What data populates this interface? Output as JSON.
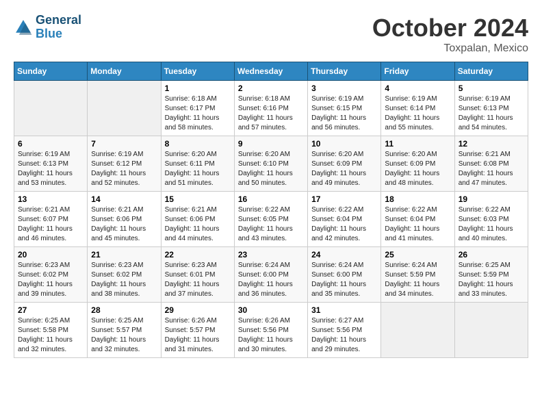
{
  "header": {
    "logo_line1": "General",
    "logo_line2": "Blue",
    "month": "October 2024",
    "location": "Toxpalan, Mexico"
  },
  "weekdays": [
    "Sunday",
    "Monday",
    "Tuesday",
    "Wednesday",
    "Thursday",
    "Friday",
    "Saturday"
  ],
  "weeks": [
    [
      {
        "day": "",
        "info": ""
      },
      {
        "day": "",
        "info": ""
      },
      {
        "day": "1",
        "info": "Sunrise: 6:18 AM\nSunset: 6:17 PM\nDaylight: 11 hours and 58 minutes."
      },
      {
        "day": "2",
        "info": "Sunrise: 6:18 AM\nSunset: 6:16 PM\nDaylight: 11 hours and 57 minutes."
      },
      {
        "day": "3",
        "info": "Sunrise: 6:19 AM\nSunset: 6:15 PM\nDaylight: 11 hours and 56 minutes."
      },
      {
        "day": "4",
        "info": "Sunrise: 6:19 AM\nSunset: 6:14 PM\nDaylight: 11 hours and 55 minutes."
      },
      {
        "day": "5",
        "info": "Sunrise: 6:19 AM\nSunset: 6:13 PM\nDaylight: 11 hours and 54 minutes."
      }
    ],
    [
      {
        "day": "6",
        "info": "Sunrise: 6:19 AM\nSunset: 6:13 PM\nDaylight: 11 hours and 53 minutes."
      },
      {
        "day": "7",
        "info": "Sunrise: 6:19 AM\nSunset: 6:12 PM\nDaylight: 11 hours and 52 minutes."
      },
      {
        "day": "8",
        "info": "Sunrise: 6:20 AM\nSunset: 6:11 PM\nDaylight: 11 hours and 51 minutes."
      },
      {
        "day": "9",
        "info": "Sunrise: 6:20 AM\nSunset: 6:10 PM\nDaylight: 11 hours and 50 minutes."
      },
      {
        "day": "10",
        "info": "Sunrise: 6:20 AM\nSunset: 6:09 PM\nDaylight: 11 hours and 49 minutes."
      },
      {
        "day": "11",
        "info": "Sunrise: 6:20 AM\nSunset: 6:09 PM\nDaylight: 11 hours and 48 minutes."
      },
      {
        "day": "12",
        "info": "Sunrise: 6:21 AM\nSunset: 6:08 PM\nDaylight: 11 hours and 47 minutes."
      }
    ],
    [
      {
        "day": "13",
        "info": "Sunrise: 6:21 AM\nSunset: 6:07 PM\nDaylight: 11 hours and 46 minutes."
      },
      {
        "day": "14",
        "info": "Sunrise: 6:21 AM\nSunset: 6:06 PM\nDaylight: 11 hours and 45 minutes."
      },
      {
        "day": "15",
        "info": "Sunrise: 6:21 AM\nSunset: 6:06 PM\nDaylight: 11 hours and 44 minutes."
      },
      {
        "day": "16",
        "info": "Sunrise: 6:22 AM\nSunset: 6:05 PM\nDaylight: 11 hours and 43 minutes."
      },
      {
        "day": "17",
        "info": "Sunrise: 6:22 AM\nSunset: 6:04 PM\nDaylight: 11 hours and 42 minutes."
      },
      {
        "day": "18",
        "info": "Sunrise: 6:22 AM\nSunset: 6:04 PM\nDaylight: 11 hours and 41 minutes."
      },
      {
        "day": "19",
        "info": "Sunrise: 6:22 AM\nSunset: 6:03 PM\nDaylight: 11 hours and 40 minutes."
      }
    ],
    [
      {
        "day": "20",
        "info": "Sunrise: 6:23 AM\nSunset: 6:02 PM\nDaylight: 11 hours and 39 minutes."
      },
      {
        "day": "21",
        "info": "Sunrise: 6:23 AM\nSunset: 6:02 PM\nDaylight: 11 hours and 38 minutes."
      },
      {
        "day": "22",
        "info": "Sunrise: 6:23 AM\nSunset: 6:01 PM\nDaylight: 11 hours and 37 minutes."
      },
      {
        "day": "23",
        "info": "Sunrise: 6:24 AM\nSunset: 6:00 PM\nDaylight: 11 hours and 36 minutes."
      },
      {
        "day": "24",
        "info": "Sunrise: 6:24 AM\nSunset: 6:00 PM\nDaylight: 11 hours and 35 minutes."
      },
      {
        "day": "25",
        "info": "Sunrise: 6:24 AM\nSunset: 5:59 PM\nDaylight: 11 hours and 34 minutes."
      },
      {
        "day": "26",
        "info": "Sunrise: 6:25 AM\nSunset: 5:59 PM\nDaylight: 11 hours and 33 minutes."
      }
    ],
    [
      {
        "day": "27",
        "info": "Sunrise: 6:25 AM\nSunset: 5:58 PM\nDaylight: 11 hours and 32 minutes."
      },
      {
        "day": "28",
        "info": "Sunrise: 6:25 AM\nSunset: 5:57 PM\nDaylight: 11 hours and 32 minutes."
      },
      {
        "day": "29",
        "info": "Sunrise: 6:26 AM\nSunset: 5:57 PM\nDaylight: 11 hours and 31 minutes."
      },
      {
        "day": "30",
        "info": "Sunrise: 6:26 AM\nSunset: 5:56 PM\nDaylight: 11 hours and 30 minutes."
      },
      {
        "day": "31",
        "info": "Sunrise: 6:27 AM\nSunset: 5:56 PM\nDaylight: 11 hours and 29 minutes."
      },
      {
        "day": "",
        "info": ""
      },
      {
        "day": "",
        "info": ""
      }
    ]
  ]
}
